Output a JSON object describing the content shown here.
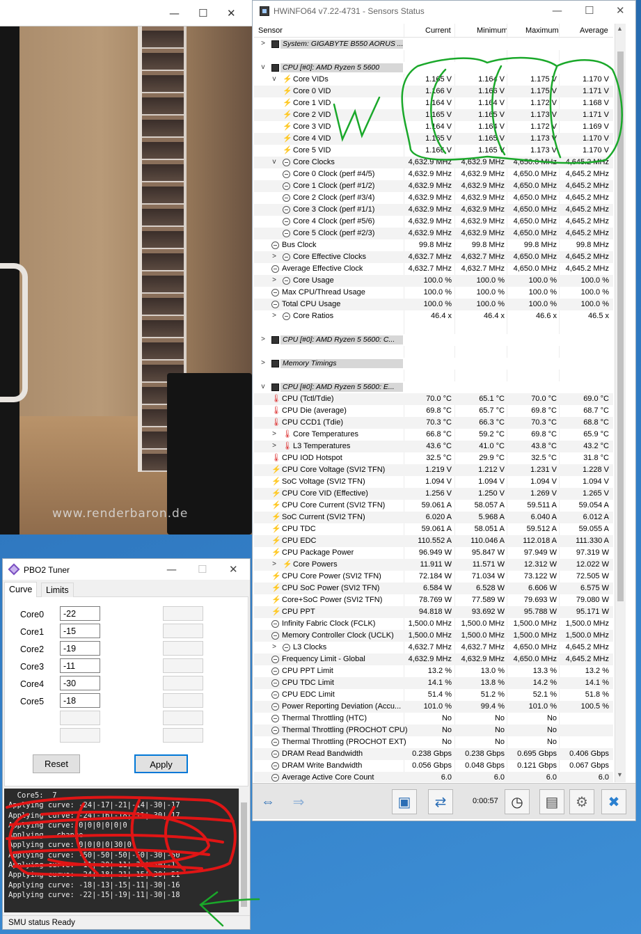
{
  "image_window": {
    "min_glyph": "—",
    "max_glyph": "☐",
    "close_glyph": "✕",
    "watermark": "www.renderbaron.de"
  },
  "hwinfo": {
    "title": "HWiNFO64 v7.22-4731 - Sensors Status",
    "window_controls": {
      "min": "—",
      "max": "☐",
      "close": "✕"
    },
    "columns": {
      "sensor": "Sensor",
      "current": "Current",
      "minimum": "Minimum",
      "maximum": "Maximum",
      "average": "Average"
    },
    "rows": [
      {
        "type": "group",
        "exp": ">",
        "label": "System: GIGABYTE B550 AORUS ..."
      },
      {
        "type": "blank"
      },
      {
        "type": "group",
        "exp": "v",
        "label": "CPU [#0]: AMD Ryzen 5 5600"
      },
      {
        "type": "item",
        "lvl": 1,
        "exp": "v",
        "icon": "bolt",
        "label": "Core VIDs",
        "cur": "1.165 V",
        "min": "1.164 V",
        "max": "1.175 V",
        "avg": "1.170 V"
      },
      {
        "type": "item",
        "lvl": 2,
        "icon": "bolt",
        "label": "Core 0 VID",
        "cur": "1.166 V",
        "min": "1.166 V",
        "max": "1.175 V",
        "avg": "1.171 V"
      },
      {
        "type": "item",
        "lvl": 2,
        "icon": "bolt",
        "label": "Core 1 VID",
        "cur": "1.164 V",
        "min": "1.164 V",
        "max": "1.172 V",
        "avg": "1.168 V"
      },
      {
        "type": "item",
        "lvl": 2,
        "icon": "bolt",
        "label": "Core 2 VID",
        "cur": "1.165 V",
        "min": "1.165 V",
        "max": "1.173 V",
        "avg": "1.171 V"
      },
      {
        "type": "item",
        "lvl": 2,
        "icon": "bolt",
        "label": "Core 3 VID",
        "cur": "1.164 V",
        "min": "1.164 V",
        "max": "1.172 V",
        "avg": "1.169 V"
      },
      {
        "type": "item",
        "lvl": 2,
        "icon": "bolt",
        "label": "Core 4 VID",
        "cur": "1.165 V",
        "min": "1.165 V",
        "max": "1.173 V",
        "avg": "1.170 V"
      },
      {
        "type": "item",
        "lvl": 2,
        "icon": "bolt",
        "label": "Core 5 VID",
        "cur": "1.166 V",
        "min": "1.165 V",
        "max": "1.173 V",
        "avg": "1.170 V"
      },
      {
        "type": "item",
        "lvl": 1,
        "exp": "v",
        "icon": "clk",
        "label": "Core Clocks",
        "cur": "4,632.9 MHz",
        "min": "4,632.9 MHz",
        "max": "4,650.0 MHz",
        "avg": "4,645.2 MHz"
      },
      {
        "type": "item",
        "lvl": 2,
        "icon": "clk",
        "label": "Core 0 Clock (perf #4/5)",
        "cur": "4,632.9 MHz",
        "min": "4,632.9 MHz",
        "max": "4,650.0 MHz",
        "avg": "4,645.2 MHz"
      },
      {
        "type": "item",
        "lvl": 2,
        "icon": "clk",
        "label": "Core 1 Clock (perf #1/2)",
        "cur": "4,632.9 MHz",
        "min": "4,632.9 MHz",
        "max": "4,650.0 MHz",
        "avg": "4,645.2 MHz"
      },
      {
        "type": "item",
        "lvl": 2,
        "icon": "clk",
        "label": "Core 2 Clock (perf #3/4)",
        "cur": "4,632.9 MHz",
        "min": "4,632.9 MHz",
        "max": "4,650.0 MHz",
        "avg": "4,645.2 MHz"
      },
      {
        "type": "item",
        "lvl": 2,
        "icon": "clk",
        "label": "Core 3 Clock (perf #1/1)",
        "cur": "4,632.9 MHz",
        "min": "4,632.9 MHz",
        "max": "4,650.0 MHz",
        "avg": "4,645.2 MHz"
      },
      {
        "type": "item",
        "lvl": 2,
        "icon": "clk",
        "label": "Core 4 Clock (perf #5/6)",
        "cur": "4,632.9 MHz",
        "min": "4,632.9 MHz",
        "max": "4,650.0 MHz",
        "avg": "4,645.2 MHz"
      },
      {
        "type": "item",
        "lvl": 2,
        "icon": "clk",
        "label": "Core 5 Clock (perf #2/3)",
        "cur": "4,632.9 MHz",
        "min": "4,632.9 MHz",
        "max": "4,650.0 MHz",
        "avg": "4,645.2 MHz"
      },
      {
        "type": "item",
        "lvl": 0,
        "icon": "clk",
        "label": "Bus Clock",
        "cur": "99.8 MHz",
        "min": "99.8 MHz",
        "max": "99.8 MHz",
        "avg": "99.8 MHz"
      },
      {
        "type": "item",
        "lvl": 1,
        "exp": ">",
        "icon": "clk",
        "label": "Core Effective Clocks",
        "cur": "4,632.7 MHz",
        "min": "4,632.7 MHz",
        "max": "4,650.0 MHz",
        "avg": "4,645.2 MHz"
      },
      {
        "type": "item",
        "lvl": 0,
        "icon": "clk",
        "label": "Average Effective Clock",
        "cur": "4,632.7 MHz",
        "min": "4,632.7 MHz",
        "max": "4,650.0 MHz",
        "avg": "4,645.2 MHz"
      },
      {
        "type": "item",
        "lvl": 1,
        "exp": ">",
        "icon": "clk",
        "label": "Core Usage",
        "cur": "100.0 %",
        "min": "100.0 %",
        "max": "100.0 %",
        "avg": "100.0 %"
      },
      {
        "type": "item",
        "lvl": 0,
        "icon": "clk",
        "label": "Max CPU/Thread Usage",
        "cur": "100.0 %",
        "min": "100.0 %",
        "max": "100.0 %",
        "avg": "100.0 %"
      },
      {
        "type": "item",
        "lvl": 0,
        "icon": "clk",
        "label": "Total CPU Usage",
        "cur": "100.0 %",
        "min": "100.0 %",
        "max": "100.0 %",
        "avg": "100.0 %"
      },
      {
        "type": "item",
        "lvl": 1,
        "exp": ">",
        "icon": "clk",
        "label": "Core Ratios",
        "cur": "46.4 x",
        "min": "46.4 x",
        "max": "46.6 x",
        "avg": "46.5 x"
      },
      {
        "type": "blank"
      },
      {
        "type": "group",
        "exp": ">",
        "label": "CPU [#0]: AMD Ryzen 5 5600: C..."
      },
      {
        "type": "blank"
      },
      {
        "type": "group",
        "exp": ">",
        "label": "Memory Timings"
      },
      {
        "type": "blank"
      },
      {
        "type": "group",
        "exp": "v",
        "label": "CPU [#0]: AMD Ryzen 5 5600: E..."
      },
      {
        "type": "item",
        "lvl": 0,
        "icon": "therm",
        "label": "CPU (Tctl/Tdie)",
        "cur": "70.0 °C",
        "min": "65.1 °C",
        "max": "70.0 °C",
        "avg": "69.0 °C"
      },
      {
        "type": "item",
        "lvl": 0,
        "icon": "therm",
        "label": "CPU Die (average)",
        "cur": "69.8 °C",
        "min": "65.7 °C",
        "max": "69.8 °C",
        "avg": "68.7 °C"
      },
      {
        "type": "item",
        "lvl": 0,
        "icon": "therm",
        "label": "CPU CCD1 (Tdie)",
        "cur": "70.3 °C",
        "min": "66.3 °C",
        "max": "70.3 °C",
        "avg": "68.8 °C"
      },
      {
        "type": "item",
        "lvl": 1,
        "exp": ">",
        "icon": "therm",
        "label": "Core Temperatures",
        "cur": "66.8 °C",
        "min": "59.2 °C",
        "max": "69.8 °C",
        "avg": "65.9 °C"
      },
      {
        "type": "item",
        "lvl": 1,
        "exp": ">",
        "icon": "therm",
        "label": "L3 Temperatures",
        "cur": "43.6 °C",
        "min": "41.0 °C",
        "max": "43.8 °C",
        "avg": "43.2 °C"
      },
      {
        "type": "item",
        "lvl": 0,
        "icon": "therm",
        "label": "CPU IOD Hotspot",
        "cur": "32.5 °C",
        "min": "29.9 °C",
        "max": "32.5 °C",
        "avg": "31.8 °C"
      },
      {
        "type": "item",
        "lvl": 0,
        "icon": "bolt",
        "label": "CPU Core Voltage (SVI2 TFN)",
        "cur": "1.219 V",
        "min": "1.212 V",
        "max": "1.231 V",
        "avg": "1.228 V"
      },
      {
        "type": "item",
        "lvl": 0,
        "icon": "bolt",
        "label": "SoC Voltage (SVI2 TFN)",
        "cur": "1.094 V",
        "min": "1.094 V",
        "max": "1.094 V",
        "avg": "1.094 V"
      },
      {
        "type": "item",
        "lvl": 0,
        "icon": "bolt",
        "label": "CPU Core VID (Effective)",
        "cur": "1.256 V",
        "min": "1.250 V",
        "max": "1.269 V",
        "avg": "1.265 V"
      },
      {
        "type": "item",
        "lvl": 0,
        "icon": "bolt",
        "label": "CPU Core Current (SVI2 TFN)",
        "cur": "59.061 A",
        "min": "58.057 A",
        "max": "59.511 A",
        "avg": "59.054 A"
      },
      {
        "type": "item",
        "lvl": 0,
        "icon": "bolt",
        "label": "SoC Current (SVI2 TFN)",
        "cur": "6.020 A",
        "min": "5.968 A",
        "max": "6.040 A",
        "avg": "6.012 A"
      },
      {
        "type": "item",
        "lvl": 0,
        "icon": "bolt",
        "label": "CPU TDC",
        "cur": "59.061 A",
        "min": "58.051 A",
        "max": "59.512 A",
        "avg": "59.055 A"
      },
      {
        "type": "item",
        "lvl": 0,
        "icon": "bolt",
        "label": "CPU EDC",
        "cur": "110.552 A",
        "min": "110.046 A",
        "max": "112.018 A",
        "avg": "111.330 A"
      },
      {
        "type": "item",
        "lvl": 0,
        "icon": "bolt",
        "label": "CPU Package Power",
        "cur": "96.949 W",
        "min": "95.847 W",
        "max": "97.949 W",
        "avg": "97.319 W"
      },
      {
        "type": "item",
        "lvl": 1,
        "exp": ">",
        "icon": "bolt",
        "label": "Core Powers",
        "cur": "11.911 W",
        "min": "11.571 W",
        "max": "12.312 W",
        "avg": "12.022 W"
      },
      {
        "type": "item",
        "lvl": 0,
        "icon": "bolt",
        "label": "CPU Core Power (SVI2 TFN)",
        "cur": "72.184 W",
        "min": "71.034 W",
        "max": "73.122 W",
        "avg": "72.505 W"
      },
      {
        "type": "item",
        "lvl": 0,
        "icon": "bolt",
        "label": "CPU SoC Power (SVI2 TFN)",
        "cur": "6.584 W",
        "min": "6.528 W",
        "max": "6.606 W",
        "avg": "6.575 W"
      },
      {
        "type": "item",
        "lvl": 0,
        "icon": "bolt",
        "label": "Core+SoC Power (SVI2 TFN)",
        "cur": "78.769 W",
        "min": "77.589 W",
        "max": "79.693 W",
        "avg": "79.080 W"
      },
      {
        "type": "item",
        "lvl": 0,
        "icon": "bolt",
        "label": "CPU PPT",
        "cur": "94.818 W",
        "min": "93.692 W",
        "max": "95.788 W",
        "avg": "95.171 W"
      },
      {
        "type": "item",
        "lvl": 0,
        "icon": "clk",
        "label": "Infinity Fabric Clock (FCLK)",
        "cur": "1,500.0 MHz",
        "min": "1,500.0 MHz",
        "max": "1,500.0 MHz",
        "avg": "1,500.0 MHz"
      },
      {
        "type": "item",
        "lvl": 0,
        "icon": "clk",
        "label": "Memory Controller Clock (UCLK)",
        "cur": "1,500.0 MHz",
        "min": "1,500.0 MHz",
        "max": "1,500.0 MHz",
        "avg": "1,500.0 MHz"
      },
      {
        "type": "item",
        "lvl": 1,
        "exp": ">",
        "icon": "clk",
        "label": "L3 Clocks",
        "cur": "4,632.7 MHz",
        "min": "4,632.7 MHz",
        "max": "4,650.0 MHz",
        "avg": "4,645.2 MHz"
      },
      {
        "type": "item",
        "lvl": 0,
        "icon": "clk",
        "label": "Frequency Limit - Global",
        "cur": "4,632.9 MHz",
        "min": "4,632.9 MHz",
        "max": "4,650.0 MHz",
        "avg": "4,645.2 MHz"
      },
      {
        "type": "item",
        "lvl": 0,
        "icon": "clk",
        "label": "CPU PPT Limit",
        "cur": "13.2 %",
        "min": "13.0 %",
        "max": "13.3 %",
        "avg": "13.2 %"
      },
      {
        "type": "item",
        "lvl": 0,
        "icon": "clk",
        "label": "CPU TDC Limit",
        "cur": "14.1 %",
        "min": "13.8 %",
        "max": "14.2 %",
        "avg": "14.1 %"
      },
      {
        "type": "item",
        "lvl": 0,
        "icon": "clk",
        "label": "CPU EDC Limit",
        "cur": "51.4 %",
        "min": "51.2 %",
        "max": "52.1 %",
        "avg": "51.8 %"
      },
      {
        "type": "item",
        "lvl": 0,
        "icon": "clk",
        "label": "Power Reporting Deviation (Accu...",
        "cur": "101.0 %",
        "min": "99.4 %",
        "max": "101.0 %",
        "avg": "100.5 %"
      },
      {
        "type": "item",
        "lvl": 0,
        "icon": "clk",
        "label": "Thermal Throttling (HTC)",
        "cur": "No",
        "min": "No",
        "max": "No",
        "avg": ""
      },
      {
        "type": "item",
        "lvl": 0,
        "icon": "clk",
        "label": "Thermal Throttling (PROCHOT CPU)",
        "cur": "No",
        "min": "No",
        "max": "No",
        "avg": ""
      },
      {
        "type": "item",
        "lvl": 0,
        "icon": "clk",
        "label": "Thermal Throttling (PROCHOT EXT)",
        "cur": "No",
        "min": "No",
        "max": "No",
        "avg": ""
      },
      {
        "type": "item",
        "lvl": 0,
        "icon": "clk",
        "label": "DRAM Read Bandwidth",
        "cur": "0.238 Gbps",
        "min": "0.238 Gbps",
        "max": "0.695 Gbps",
        "avg": "0.406 Gbps"
      },
      {
        "type": "item",
        "lvl": 0,
        "icon": "clk",
        "label": "DRAM Write Bandwidth",
        "cur": "0.056 Gbps",
        "min": "0.048 Gbps",
        "max": "0.121 Gbps",
        "avg": "0.067 Gbps"
      },
      {
        "type": "item",
        "lvl": 0,
        "icon": "clk",
        "label": "Average Active Core Count",
        "cur": "6.0",
        "min": "6.0",
        "max": "6.0",
        "avg": "6.0"
      }
    ],
    "toolbar": {
      "nav_left": "⇔",
      "nav_right": "⇒",
      "timer": "0:00:57",
      "clock_icon": "◷",
      "report_icon": "▤",
      "settings_icon": "⚙",
      "close_icon": "✖",
      "network_icon": "⇄",
      "monitor_icon": "▣"
    },
    "scroll_up": "▲",
    "scroll_down": "▼"
  },
  "pbo2": {
    "title": "PBO2 Tuner",
    "window_controls": {
      "min": "—",
      "max": "☐",
      "close": "✕"
    },
    "tabs": [
      "Curve",
      "Limits"
    ],
    "cores": [
      {
        "label": "Core0",
        "value": "-22"
      },
      {
        "label": "Core1",
        "value": "-15"
      },
      {
        "label": "Core2",
        "value": "-19"
      },
      {
        "label": "Core3",
        "value": "-11"
      },
      {
        "label": "Core4",
        "value": "-30"
      },
      {
        "label": "Core5",
        "value": "-18"
      }
    ],
    "reset_label": "Reset",
    "apply_label": "Apply",
    "log_lines": [
      "  Core5:  7",
      "Applying curve: -24|-17|-21|-14|-30|-17",
      "Applying curve: -24|-16|-18|-11|-30|-17",
      "Applying curve: 0|0|0|0|0|0",
      "Applying . change",
      "Applying curve: 0|0|0|0|30|0",
      "Applying curve: -50|-50|-50|-50|-30|-50",
      "Applying curve: -11|-30|-11|-30|-30|-11",
      "Applying curve: -24|-18|-21|-15|-30|-21",
      "Applying curve: -18|-13|-15|-11|-30|-16",
      "Applying curve: -22|-15|-19|-11|-30|-18"
    ],
    "status": "SMU status Ready"
  },
  "colors": {
    "annotation_green": "#1aa82a",
    "annotation_red": "#e01515",
    "apply_border": "#0078d7"
  }
}
